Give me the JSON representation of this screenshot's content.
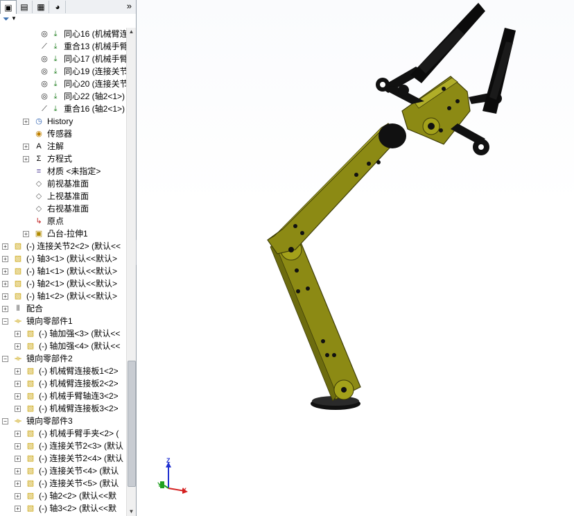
{
  "tabs": [
    {
      "name": "feature-manager-tab-icon",
      "active": true,
      "glyph": "▣"
    },
    {
      "name": "property-manager-tab-icon",
      "active": false,
      "glyph": "▤"
    },
    {
      "name": "configuration-manager-tab-icon",
      "active": false,
      "glyph": "▦"
    },
    {
      "name": "display-manager-tab-icon",
      "active": false,
      "glyph": "◕"
    }
  ],
  "more_glyph": "»",
  "filter_glyph": "▼",
  "tree": [
    {
      "label": "同心16 (机械臂连接",
      "icon": "concentric-icon",
      "level": 3
    },
    {
      "label": "重合13 (机械手臂",
      "icon": "coincident-icon",
      "level": 3
    },
    {
      "label": "同心17 (机械手臂",
      "icon": "concentric-icon",
      "level": 3
    },
    {
      "label": "同心19 (连接关节",
      "icon": "concentric-icon",
      "level": 3
    },
    {
      "label": "同心20 (连接关节",
      "icon": "concentric-icon",
      "level": 3
    },
    {
      "label": "同心22 (轴2<1>)",
      "icon": "concentric-icon",
      "level": 3
    },
    {
      "label": "重合16 (轴2<1>)",
      "icon": "coincident-icon",
      "level": 3
    },
    {
      "label": "History",
      "icon": "history-icon",
      "level": 2,
      "expand": true
    },
    {
      "label": "传感器",
      "icon": "sensor-icon",
      "level": 2
    },
    {
      "label": "注解",
      "icon": "annotation-icon",
      "level": 2,
      "expand": true
    },
    {
      "label": "方程式",
      "icon": "equation-icon",
      "level": 2,
      "expand": true
    },
    {
      "label": "材质 <未指定>",
      "icon": "material-icon",
      "level": 2
    },
    {
      "label": "前视基准面",
      "icon": "plane-icon",
      "level": 2
    },
    {
      "label": "上视基准面",
      "icon": "plane-icon",
      "level": 2
    },
    {
      "label": "右视基准面",
      "icon": "plane-icon",
      "level": 2
    },
    {
      "label": "原点",
      "icon": "origin-icon",
      "level": 2
    },
    {
      "label": "凸台-拉伸1",
      "icon": "extrude-icon",
      "level": 2,
      "expand": true
    },
    {
      "label": "(-) 连接关节2<2> (默认<<",
      "icon": "part-icon",
      "level": 0,
      "expand": true
    },
    {
      "label": "(-) 轴3<1> (默认<<默认>",
      "icon": "part-icon",
      "level": 0,
      "expand": true
    },
    {
      "label": "(-) 轴1<1> (默认<<默认>",
      "icon": "part-icon",
      "level": 0,
      "expand": true
    },
    {
      "label": "(-) 轴2<1> (默认<<默认>",
      "icon": "part-icon",
      "level": 0,
      "expand": true
    },
    {
      "label": "(-) 轴1<2> (默认<<默认>",
      "icon": "part-icon",
      "level": 0,
      "expand": true
    },
    {
      "label": "配合",
      "icon": "mates-icon",
      "level": 0,
      "expand": true
    },
    {
      "label": "镜向零部件1",
      "icon": "mirror-icon",
      "level": 0,
      "expand": true,
      "open": true
    },
    {
      "label": "(-) 轴加强<3> (默认<<",
      "icon": "part-icon",
      "level": 1,
      "expand": true
    },
    {
      "label": "(-) 轴加强<4> (默认<<",
      "icon": "part-icon",
      "level": 1,
      "expand": true
    },
    {
      "label": "镜向零部件2",
      "icon": "mirror-icon",
      "level": 0,
      "expand": true,
      "open": true
    },
    {
      "label": "(-) 机械臂连接板1<2>",
      "icon": "part-icon",
      "level": 1,
      "expand": true
    },
    {
      "label": "(-) 机械臂连接板2<2>",
      "icon": "part-icon",
      "level": 1,
      "expand": true
    },
    {
      "label": "(-) 机械手臂轴连3<2>",
      "icon": "part-icon",
      "level": 1,
      "expand": true
    },
    {
      "label": "(-) 机械臂连接板3<2>",
      "icon": "part-icon",
      "level": 1,
      "expand": true
    },
    {
      "label": "镜向零部件3",
      "icon": "mirror-icon",
      "level": 0,
      "expand": true,
      "open": true
    },
    {
      "label": "(-) 机械手臂手夹<2> (",
      "icon": "part-icon",
      "level": 1,
      "expand": true
    },
    {
      "label": "(-) 连接关节2<3> (默认",
      "icon": "part-icon",
      "level": 1,
      "expand": true
    },
    {
      "label": "(-) 连接关节2<4> (默认",
      "icon": "part-icon",
      "level": 1,
      "expand": true
    },
    {
      "label": "(-) 连接关节<4> (默认",
      "icon": "part-icon",
      "level": 1,
      "expand": true
    },
    {
      "label": "(-) 连接关节<5> (默认",
      "icon": "part-icon",
      "level": 1,
      "expand": true
    },
    {
      "label": "(-) 轴2<2> (默认<<默",
      "icon": "part-icon",
      "level": 1,
      "expand": true
    },
    {
      "label": "(-) 轴3<2> (默认<<默",
      "icon": "part-icon",
      "level": 1,
      "expand": true
    }
  ],
  "triad": {
    "z": "Z",
    "y": "Y",
    "x": "X"
  },
  "colors": {
    "arm": "#8c8a14",
    "arm_dark": "#4a4908",
    "gripper": "#0b0b0b",
    "triad_x": "#d42020",
    "triad_y": "#20a020",
    "triad_z": "#2030d0"
  }
}
